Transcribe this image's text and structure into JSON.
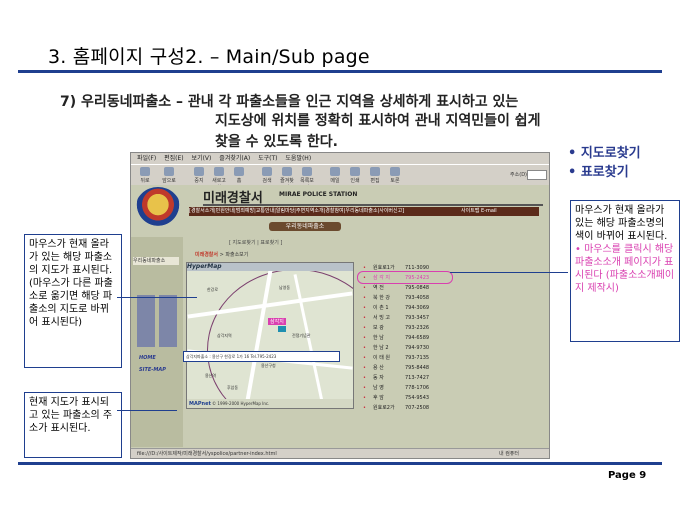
{
  "slide": {
    "title": "3. 홈페이지 구성2. – Main/Sub page",
    "heading_line1": "7) 우리동네파출소 – 관내 각 파출소들을 인근 지역을 상세하게 표시하고 있는",
    "heading_line2": "지도상에 위치를 정확히 표시하여 관내 지역민들이 쉽게",
    "heading_line3": "찾을 수 있도록 한다.",
    "bullets": [
      "• 지도로찾기",
      "• 표로찾기"
    ],
    "page_number": "Page 9",
    "accent_color": "#1f3f8f",
    "highlight_color": "#d93fb0"
  },
  "callouts": {
    "left": "마우스가 현재 올라가 있는 해당 파출소의 지도가 표시된다. (마우스가 다른 파출소로 옮기면 해당 파출소의 지도로 바뀌어 표시된다)",
    "bottom": "현재 지도가 표시되고 있는 파출소의 주소가 표시된다.",
    "right_main": "마우스가 현재 올라가 있는 해당 파출소명의 색이 바뀌어 표시된다.",
    "right_pink": "• 마우스를 클릭시 해당파출소소개 페이지가 표시된다 (파출소소개페이지 제작시)"
  },
  "browser": {
    "menu": [
      "파일(F)",
      "편집(E)",
      "보기(V)",
      "즐겨찾기(A)",
      "도구(T)",
      "도움말(H)"
    ],
    "toolbar": [
      "뒤로",
      "앞으로",
      "중지",
      "새로고침",
      "홈",
      "검색",
      "즐겨찾기",
      "목록보기",
      "메일",
      "인쇄",
      "편집",
      "토론"
    ],
    "address_label": "주소(D)",
    "status_text": "file:///D:/사이트제작/미래경찰서/yspolice/partner-index.html",
    "status_zone": "내 컴퓨터"
  },
  "site": {
    "title": "미래경찰서",
    "title_eng": "MIRAE POLICE STATION",
    "nav": "[경찰서소개|민원안내|범죄예방|교통안내|알림마당|주변지역소개|경찰참여|우리동네파출소|사이버신고]",
    "nav_extra": "사이트맵 E-mail",
    "left_menu": "우리동네파출소",
    "home_link": "HOME",
    "sitemap_link": "SITE-MAP",
    "section_banner": "우리동네파출소",
    "sub_links": "[ 지도로찾기 | 표로찾기 ]",
    "breadcrumb_site": "미래경찰서",
    "breadcrumb_rest": " > 파출소보기"
  },
  "map": {
    "header": "HyperMap",
    "station_label": "삼각지",
    "logo": "MAPnet",
    "copyright": "© 1999-2000 HyperMap Inc.",
    "address_box": "삼각지파출소 : 용산구 한강로 1가 16  Tel.795-2423",
    "labels": [
      "한강로",
      "삼각지역",
      "전쟁기념관",
      "국방부",
      "용산구청",
      "용산역",
      "남영동",
      "후암동"
    ]
  },
  "stations": [
    {
      "name": "원효로1가",
      "phone": "711-3090",
      "active": false
    },
    {
      "name": "삼 각 지",
      "phone": "795-2423",
      "active": true
    },
    {
      "name": "역    전",
      "phone": "795-0848",
      "active": false
    },
    {
      "name": "북 한 강",
      "phone": "793-4058",
      "active": false
    },
    {
      "name": "이 촌 1",
      "phone": "794-3069",
      "active": false
    },
    {
      "name": "서 빙 고",
      "phone": "793-3457",
      "active": false
    },
    {
      "name": "보    광",
      "phone": "793-2326",
      "active": false
    },
    {
      "name": "한    남",
      "phone": "794-6589",
      "active": false
    },
    {
      "name": "한 남 2",
      "phone": "794-9730",
      "active": false
    },
    {
      "name": "이 태 원",
      "phone": "793-7135",
      "active": false
    },
    {
      "name": "용    산",
      "phone": "795-8448",
      "active": false
    },
    {
      "name": "동    자",
      "phone": "713-7427",
      "active": false
    },
    {
      "name": "남    영",
      "phone": "778-1706",
      "active": false
    },
    {
      "name": "후    암",
      "phone": "754-9543",
      "active": false
    },
    {
      "name": "원효로2가",
      "phone": "707-2508",
      "active": false
    }
  ]
}
